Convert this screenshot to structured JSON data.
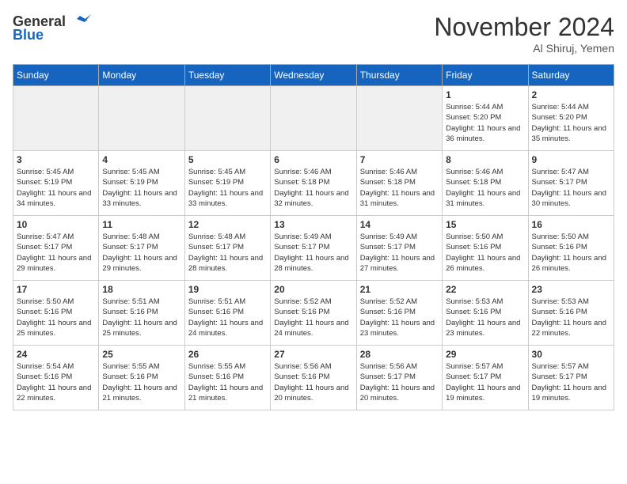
{
  "header": {
    "logo_line1": "General",
    "logo_line2": "Blue",
    "month_title": "November 2024",
    "location": "Al Shiruj, Yemen"
  },
  "weekdays": [
    "Sunday",
    "Monday",
    "Tuesday",
    "Wednesday",
    "Thursday",
    "Friday",
    "Saturday"
  ],
  "weeks": [
    [
      {
        "day": "",
        "info": ""
      },
      {
        "day": "",
        "info": ""
      },
      {
        "day": "",
        "info": ""
      },
      {
        "day": "",
        "info": ""
      },
      {
        "day": "",
        "info": ""
      },
      {
        "day": "1",
        "info": "Sunrise: 5:44 AM\nSunset: 5:20 PM\nDaylight: 11 hours and 36 minutes."
      },
      {
        "day": "2",
        "info": "Sunrise: 5:44 AM\nSunset: 5:20 PM\nDaylight: 11 hours and 35 minutes."
      }
    ],
    [
      {
        "day": "3",
        "info": "Sunrise: 5:45 AM\nSunset: 5:19 PM\nDaylight: 11 hours and 34 minutes."
      },
      {
        "day": "4",
        "info": "Sunrise: 5:45 AM\nSunset: 5:19 PM\nDaylight: 11 hours and 33 minutes."
      },
      {
        "day": "5",
        "info": "Sunrise: 5:45 AM\nSunset: 5:19 PM\nDaylight: 11 hours and 33 minutes."
      },
      {
        "day": "6",
        "info": "Sunrise: 5:46 AM\nSunset: 5:18 PM\nDaylight: 11 hours and 32 minutes."
      },
      {
        "day": "7",
        "info": "Sunrise: 5:46 AM\nSunset: 5:18 PM\nDaylight: 11 hours and 31 minutes."
      },
      {
        "day": "8",
        "info": "Sunrise: 5:46 AM\nSunset: 5:18 PM\nDaylight: 11 hours and 31 minutes."
      },
      {
        "day": "9",
        "info": "Sunrise: 5:47 AM\nSunset: 5:17 PM\nDaylight: 11 hours and 30 minutes."
      }
    ],
    [
      {
        "day": "10",
        "info": "Sunrise: 5:47 AM\nSunset: 5:17 PM\nDaylight: 11 hours and 29 minutes."
      },
      {
        "day": "11",
        "info": "Sunrise: 5:48 AM\nSunset: 5:17 PM\nDaylight: 11 hours and 29 minutes."
      },
      {
        "day": "12",
        "info": "Sunrise: 5:48 AM\nSunset: 5:17 PM\nDaylight: 11 hours and 28 minutes."
      },
      {
        "day": "13",
        "info": "Sunrise: 5:49 AM\nSunset: 5:17 PM\nDaylight: 11 hours and 28 minutes."
      },
      {
        "day": "14",
        "info": "Sunrise: 5:49 AM\nSunset: 5:17 PM\nDaylight: 11 hours and 27 minutes."
      },
      {
        "day": "15",
        "info": "Sunrise: 5:50 AM\nSunset: 5:16 PM\nDaylight: 11 hours and 26 minutes."
      },
      {
        "day": "16",
        "info": "Sunrise: 5:50 AM\nSunset: 5:16 PM\nDaylight: 11 hours and 26 minutes."
      }
    ],
    [
      {
        "day": "17",
        "info": "Sunrise: 5:50 AM\nSunset: 5:16 PM\nDaylight: 11 hours and 25 minutes."
      },
      {
        "day": "18",
        "info": "Sunrise: 5:51 AM\nSunset: 5:16 PM\nDaylight: 11 hours and 25 minutes."
      },
      {
        "day": "19",
        "info": "Sunrise: 5:51 AM\nSunset: 5:16 PM\nDaylight: 11 hours and 24 minutes."
      },
      {
        "day": "20",
        "info": "Sunrise: 5:52 AM\nSunset: 5:16 PM\nDaylight: 11 hours and 24 minutes."
      },
      {
        "day": "21",
        "info": "Sunrise: 5:52 AM\nSunset: 5:16 PM\nDaylight: 11 hours and 23 minutes."
      },
      {
        "day": "22",
        "info": "Sunrise: 5:53 AM\nSunset: 5:16 PM\nDaylight: 11 hours and 23 minutes."
      },
      {
        "day": "23",
        "info": "Sunrise: 5:53 AM\nSunset: 5:16 PM\nDaylight: 11 hours and 22 minutes."
      }
    ],
    [
      {
        "day": "24",
        "info": "Sunrise: 5:54 AM\nSunset: 5:16 PM\nDaylight: 11 hours and 22 minutes."
      },
      {
        "day": "25",
        "info": "Sunrise: 5:55 AM\nSunset: 5:16 PM\nDaylight: 11 hours and 21 minutes."
      },
      {
        "day": "26",
        "info": "Sunrise: 5:55 AM\nSunset: 5:16 PM\nDaylight: 11 hours and 21 minutes."
      },
      {
        "day": "27",
        "info": "Sunrise: 5:56 AM\nSunset: 5:16 PM\nDaylight: 11 hours and 20 minutes."
      },
      {
        "day": "28",
        "info": "Sunrise: 5:56 AM\nSunset: 5:17 PM\nDaylight: 11 hours and 20 minutes."
      },
      {
        "day": "29",
        "info": "Sunrise: 5:57 AM\nSunset: 5:17 PM\nDaylight: 11 hours and 19 minutes."
      },
      {
        "day": "30",
        "info": "Sunrise: 5:57 AM\nSunset: 5:17 PM\nDaylight: 11 hours and 19 minutes."
      }
    ]
  ]
}
